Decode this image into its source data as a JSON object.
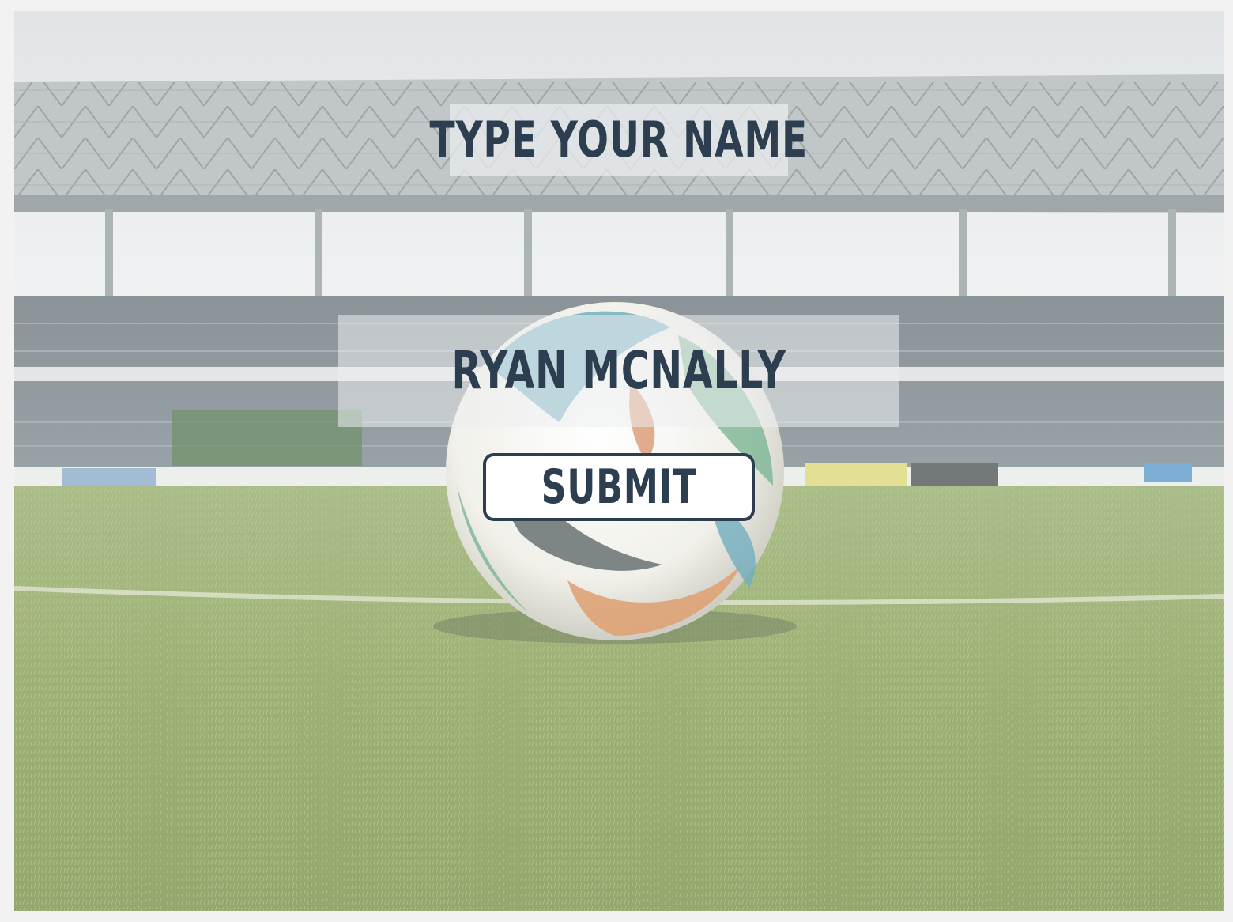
{
  "form": {
    "title": "TYPE YOUR NAME",
    "name_value": "RYAN MCNALLY",
    "submit_label": "SUBMIT"
  },
  "colors": {
    "text": "#2c3e50",
    "button_border": "#2c3e50",
    "button_bg": "#ffffff",
    "grass": "#7f9a4a",
    "sky": "#dfe3e6"
  },
  "background": {
    "image": "stadium-soccer-ball-photo"
  }
}
